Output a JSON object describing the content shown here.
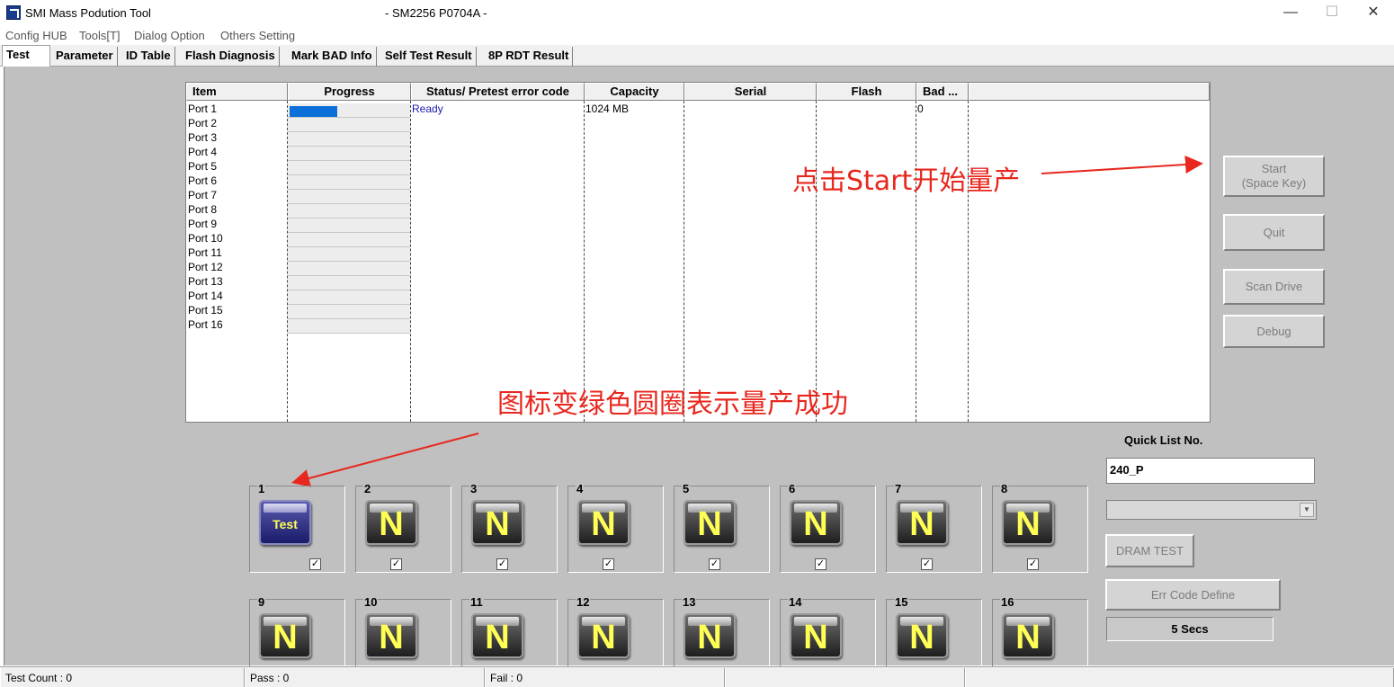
{
  "window": {
    "title": "SMI Mass Podution Tool",
    "subtitle": "- SM2256 P0704A -",
    "minimize": "—",
    "maximize": "☐",
    "close": "✕"
  },
  "menu": [
    "Config HUB",
    "Tools[T]",
    "Dialog Option",
    "Others Setting"
  ],
  "tabs": [
    "Test",
    "Parameter",
    "ID Table",
    "Flash Diagnosis",
    "Mark BAD Info",
    "Self Test Result",
    "8P RDT Result"
  ],
  "grid": {
    "columns": [
      "Item",
      "Progress",
      "Status/ Pretest error code",
      "Capacity",
      "Serial",
      "Flash",
      "Bad ..."
    ],
    "rows": [
      {
        "item": "Port 1",
        "progress": 0.4,
        "status": "Ready",
        "capacity": "1024 MB",
        "serial": "",
        "flash": "",
        "bad": "0"
      },
      {
        "item": "Port 2"
      },
      {
        "item": "Port 3"
      },
      {
        "item": "Port 4"
      },
      {
        "item": "Port 5"
      },
      {
        "item": "Port 6"
      },
      {
        "item": "Port 7"
      },
      {
        "item": "Port 8"
      },
      {
        "item": "Port 9"
      },
      {
        "item": "Port 10"
      },
      {
        "item": "Port 11"
      },
      {
        "item": "Port 12"
      },
      {
        "item": "Port 13"
      },
      {
        "item": "Port 14"
      },
      {
        "item": "Port 15"
      },
      {
        "item": "Port 16"
      }
    ]
  },
  "annotations": {
    "start_hint": "点击Start开始量产",
    "icon_hint": "图标变绿色圆圈表示量产成功"
  },
  "buttons": {
    "start": "Start",
    "start_sub": "(Space Key)",
    "quit": "Quit",
    "scan": "Scan Drive",
    "debug": "Debug",
    "dram": "DRAM TEST",
    "err": "Err Code Define"
  },
  "quick_list": {
    "label": "Quick List No.",
    "value": "240_P"
  },
  "secs": "5 Secs",
  "ports": [
    {
      "num": "1",
      "icon": "Test",
      "checked": true
    },
    {
      "num": "2",
      "icon": "N",
      "checked": true
    },
    {
      "num": "3",
      "icon": "N",
      "checked": true
    },
    {
      "num": "4",
      "icon": "N",
      "checked": true
    },
    {
      "num": "5",
      "icon": "N",
      "checked": true
    },
    {
      "num": "6",
      "icon": "N",
      "checked": true
    },
    {
      "num": "7",
      "icon": "N",
      "checked": true
    },
    {
      "num": "8",
      "icon": "N",
      "checked": true
    },
    {
      "num": "9",
      "icon": "N"
    },
    {
      "num": "10",
      "icon": "N"
    },
    {
      "num": "11",
      "icon": "N"
    },
    {
      "num": "12",
      "icon": "N"
    },
    {
      "num": "13",
      "icon": "N"
    },
    {
      "num": "14",
      "icon": "N"
    },
    {
      "num": "15",
      "icon": "N"
    },
    {
      "num": "16",
      "icon": "N"
    }
  ],
  "status": {
    "test_count": "Test Count : 0",
    "pass": "Pass : 0",
    "fail": "Fail : 0"
  },
  "colors": {
    "progress": "#0a6fd8",
    "status_ready": "#1a1ab0",
    "annotation": "#e8281f",
    "icon_letter": "#ffff55"
  }
}
